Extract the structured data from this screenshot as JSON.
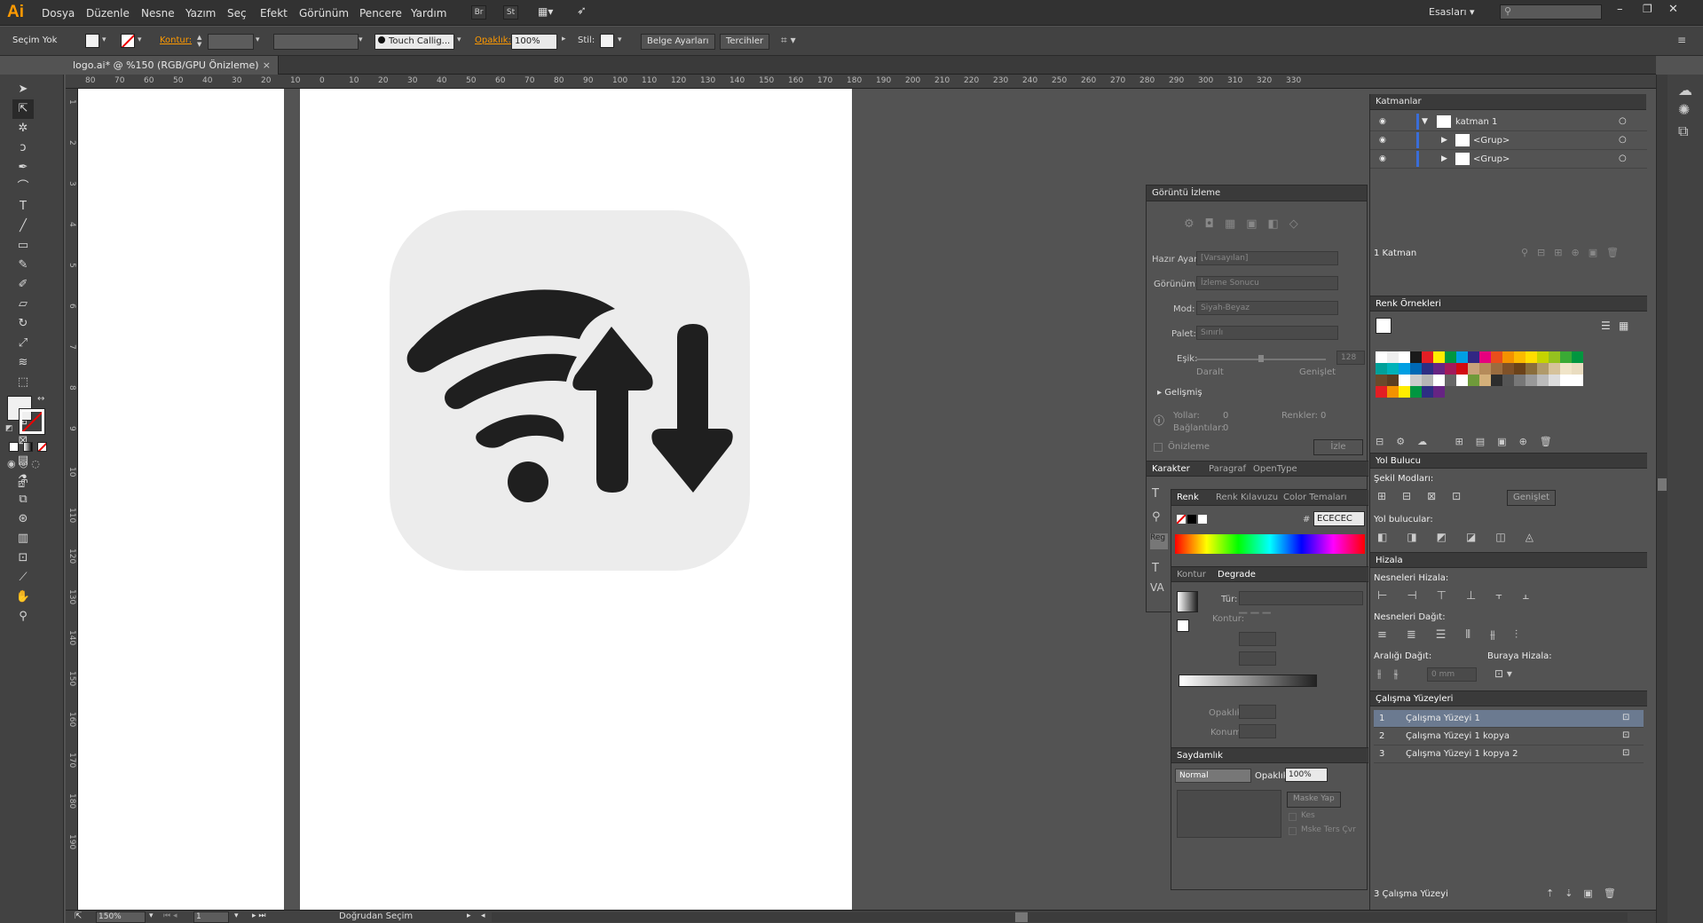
{
  "app": {
    "logo": "Ai"
  },
  "menu": [
    "Dosya",
    "Düzenle",
    "Nesne",
    "Yazım",
    "Seç",
    "Efekt",
    "Görünüm",
    "Pencere",
    "Yardım"
  ],
  "menu_icons": [
    "Br",
    "St"
  ],
  "workspace": {
    "name": "Esasları",
    "search_placeholder": ""
  },
  "control": {
    "selection": "Seçim Yok",
    "stroke_label": "Kontur:",
    "brush": "Touch Callig...",
    "opacity_label": "Opaklık:",
    "opacity_value": "100%",
    "style_label": "Stil:",
    "doc_setup": "Belge Ayarları",
    "prefs": "Tercihler"
  },
  "doc_tab": {
    "title": "logo.ai* @ %150 (RGB/GPU Önizleme)",
    "close": "×"
  },
  "hruler_ticks": [
    "80",
    "70",
    "60",
    "50",
    "40",
    "30",
    "20",
    "10",
    "0",
    "10",
    "20",
    "30",
    "40",
    "50",
    "60",
    "70",
    "80",
    "90",
    "100",
    "110",
    "120",
    "130",
    "140",
    "150",
    "160",
    "170",
    "180",
    "190",
    "200",
    "210",
    "220",
    "230",
    "240",
    "250",
    "260",
    "270",
    "280",
    "290",
    "300",
    "310",
    "320",
    "330"
  ],
  "vruler_ticks": [
    "1",
    "2",
    "3",
    "4",
    "5",
    "6",
    "7",
    "8",
    "9",
    "10",
    "110",
    "120",
    "130",
    "140",
    "150",
    "160",
    "170",
    "180",
    "190"
  ],
  "image_trace": {
    "title": "Görüntü İzleme",
    "preset_label": "Hazır Ayar:",
    "preset_value": "[Varsayılan]",
    "view_label": "Görünüm:",
    "view_value": "İzleme Sonucu",
    "mode_label": "Mod:",
    "mode_value": "Siyah-Beyaz",
    "palette_label": "Palet:",
    "palette_value": "Sınırlı",
    "threshold_label": "Eşik:",
    "threshold_value": "128",
    "less": "Daralt",
    "more": "Genişlet",
    "advanced": "Gelişmiş",
    "paths_label": "Yollar:",
    "paths_value": "0",
    "colors_label": "Renkler:",
    "colors_value": "0",
    "anchors_label": "Bağlantılar:",
    "anchors_value": "0",
    "preview": "Önizleme",
    "trace": "İzle"
  },
  "char_tabs": [
    "Karakter",
    "Paragraf",
    "OpenType"
  ],
  "color_tabs": [
    "Renk",
    "Renk Kılavuzu",
    "Color Temaları"
  ],
  "color": {
    "hash": "#",
    "hex": "ECECEC"
  },
  "grad_tabs": [
    "Kontur",
    "Degrade"
  ],
  "gradient": {
    "type_label": "Tür:",
    "stroke_label": "Kontur:",
    "opacity_label": "Opaklık:",
    "location_label": "Konum:"
  },
  "transparency": {
    "title": "Saydamlık",
    "blend": "Normal",
    "opacity_label": "Opaklık:",
    "opacity_value": "100%",
    "mask": "Maske Yap",
    "clip": "Kes",
    "invert": "Mske Ters Çvr"
  },
  "layers": {
    "title": "Katmanlar",
    "rows": [
      {
        "name": "katman 1"
      },
      {
        "name": "<Grup>"
      },
      {
        "name": "<Grup>"
      }
    ],
    "footer": "1 Katman"
  },
  "swatches": {
    "title": "Renk Örnekleri"
  },
  "pathfinder": {
    "title": "Yol Bulucu",
    "shape_modes": "Şekil Modları:",
    "expand": "Genişlet",
    "pathfinders": "Yol bulucular:"
  },
  "align": {
    "title": "Hizala",
    "align_objects": "Nesneleri Hizala:",
    "distribute_objects": "Nesneleri Dağıt:",
    "distribute_spacing": "Aralığı Dağıt:",
    "align_to": "Buraya Hizala:",
    "spacing_value": "0 mm"
  },
  "artboards": {
    "title": "Çalışma Yüzeyleri",
    "rows": [
      {
        "num": "1",
        "name": "Çalışma Yüzeyi 1"
      },
      {
        "num": "2",
        "name": "Çalışma Yüzeyi 1 kopya"
      },
      {
        "num": "3",
        "name": "Çalışma Yüzeyi 1 kopya 2"
      }
    ],
    "footer": "3 Çalışma Yüzeyi"
  },
  "status": {
    "zoom": "150%",
    "page": "1",
    "tool": "Doğrudan Seçim"
  },
  "colors": {
    "fill": "#ECECEC",
    "icon": "#1f1f1f",
    "accent": "#ff9a00"
  }
}
